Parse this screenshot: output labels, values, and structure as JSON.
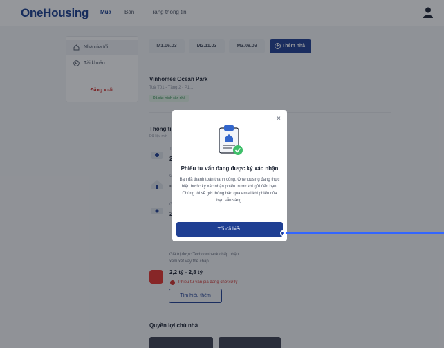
{
  "header": {
    "logo": "OneHousing",
    "nav": [
      "Mua",
      "Bán",
      "Trang thông tin"
    ]
  },
  "sidebar": {
    "items": [
      {
        "label": "Nhà của tôi",
        "icon": "home-icon"
      },
      {
        "label": "Tài khoản",
        "icon": "user-circle-icon"
      }
    ],
    "logout": "Đăng xuất"
  },
  "main": {
    "tabs": [
      "M1.06.03",
      "M2.11.03",
      "M3.08.09"
    ],
    "add_tab": "Thêm nhà",
    "project": {
      "name": "Vinhomes Ocean Park",
      "unit": "Toà T01 - Tầng 2 - P1.1",
      "verified": "Đã xác minh căn nhà"
    },
    "info_title": "Thông tin",
    "info_sub": "Dữ liệu mới",
    "rows": [
      {
        "line": "T",
        "value": "2"
      },
      {
        "line": "G",
        "value": "-"
      },
      {
        "line": "G",
        "value": "2"
      }
    ],
    "tcb_text": [
      "Giá trị được Techcombank chấp nhận",
      "xem xét vay thế chấp"
    ],
    "price": "2,2 tỷ - 2,8 tỷ",
    "pending": "Phiếu tư vấn giá đang chờ xử lý",
    "more_btn": "Tìm hiểu thêm",
    "rights": "Quyền lợi chủ nhà"
  },
  "modal": {
    "title": "Phiếu tư vấn đang được ký xác nhận",
    "body": "Bạn đã thanh toán thành công. Onehousing đang thực hiện bước ký xác nhận phiếu trước khi gửi đến bạn. Chúng tôi sẽ gửi thông báo qua email khi phiếu của bạn sẵn sàng.",
    "button": "Tôi đã hiểu",
    "close": "×"
  },
  "colors": {
    "brand": "#1f3f93",
    "danger": "#d0312d",
    "success": "#3fbf6a"
  }
}
